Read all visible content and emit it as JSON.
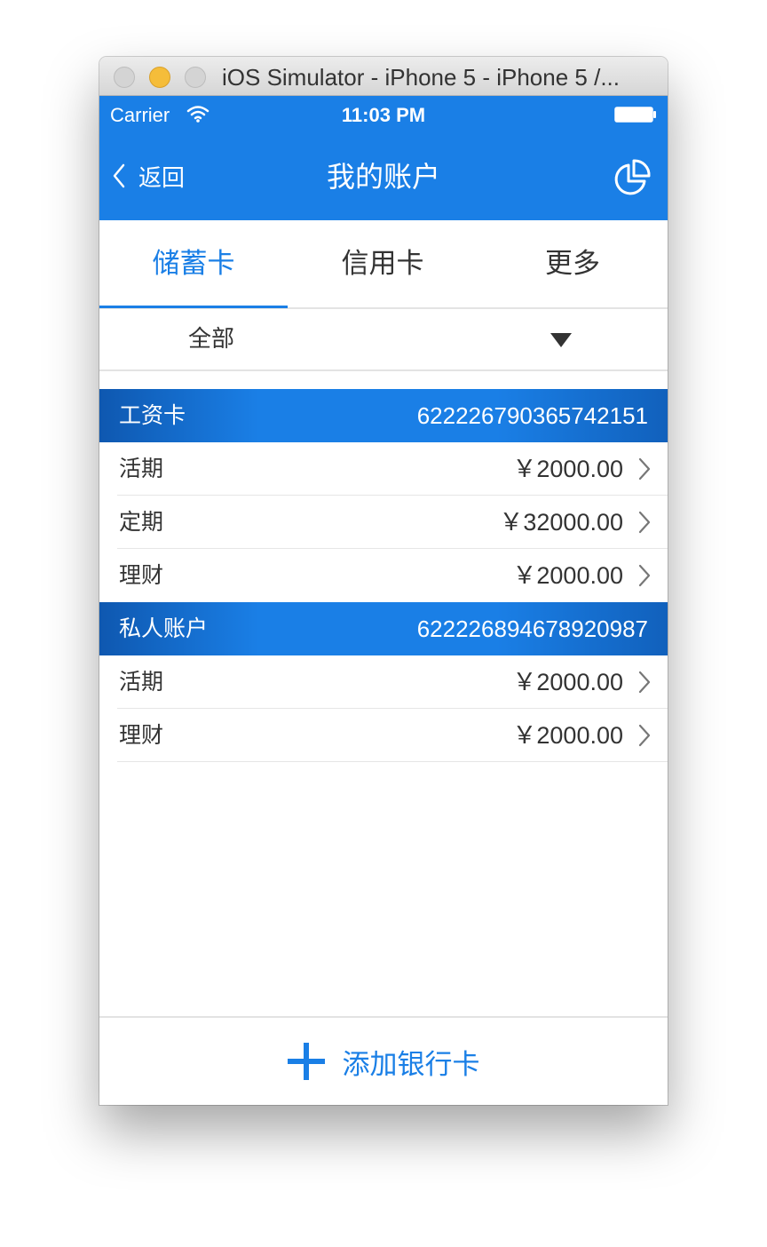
{
  "window": {
    "title": "iOS Simulator - iPhone 5 - iPhone 5 /..."
  },
  "status_bar": {
    "carrier": "Carrier",
    "time": "11:03 PM"
  },
  "nav": {
    "back_label": "返回",
    "title": "我的账户"
  },
  "tabs": [
    {
      "label": "储蓄卡",
      "selected": true
    },
    {
      "label": "信用卡",
      "selected": false
    },
    {
      "label": "更多",
      "selected": false
    }
  ],
  "filter": {
    "value": "全部"
  },
  "accounts": [
    {
      "name": "工资卡",
      "number": "6222267903657421​51",
      "items": [
        {
          "label": "活期",
          "amount": "￥2000.00"
        },
        {
          "label": "定期",
          "amount": "￥32000.00"
        },
        {
          "label": "理财",
          "amount": "￥2000.00"
        }
      ]
    },
    {
      "name": "私人账户",
      "number": "622226894678920987",
      "items": [
        {
          "label": "活期",
          "amount": "￥2000.00"
        },
        {
          "label": "理财",
          "amount": "￥2000.00"
        }
      ]
    }
  ],
  "add_card": {
    "label": "添加银行卡"
  },
  "colors": {
    "accent": "#1a7fe6",
    "text": "#333333",
    "divider": "#e3e3e3"
  }
}
